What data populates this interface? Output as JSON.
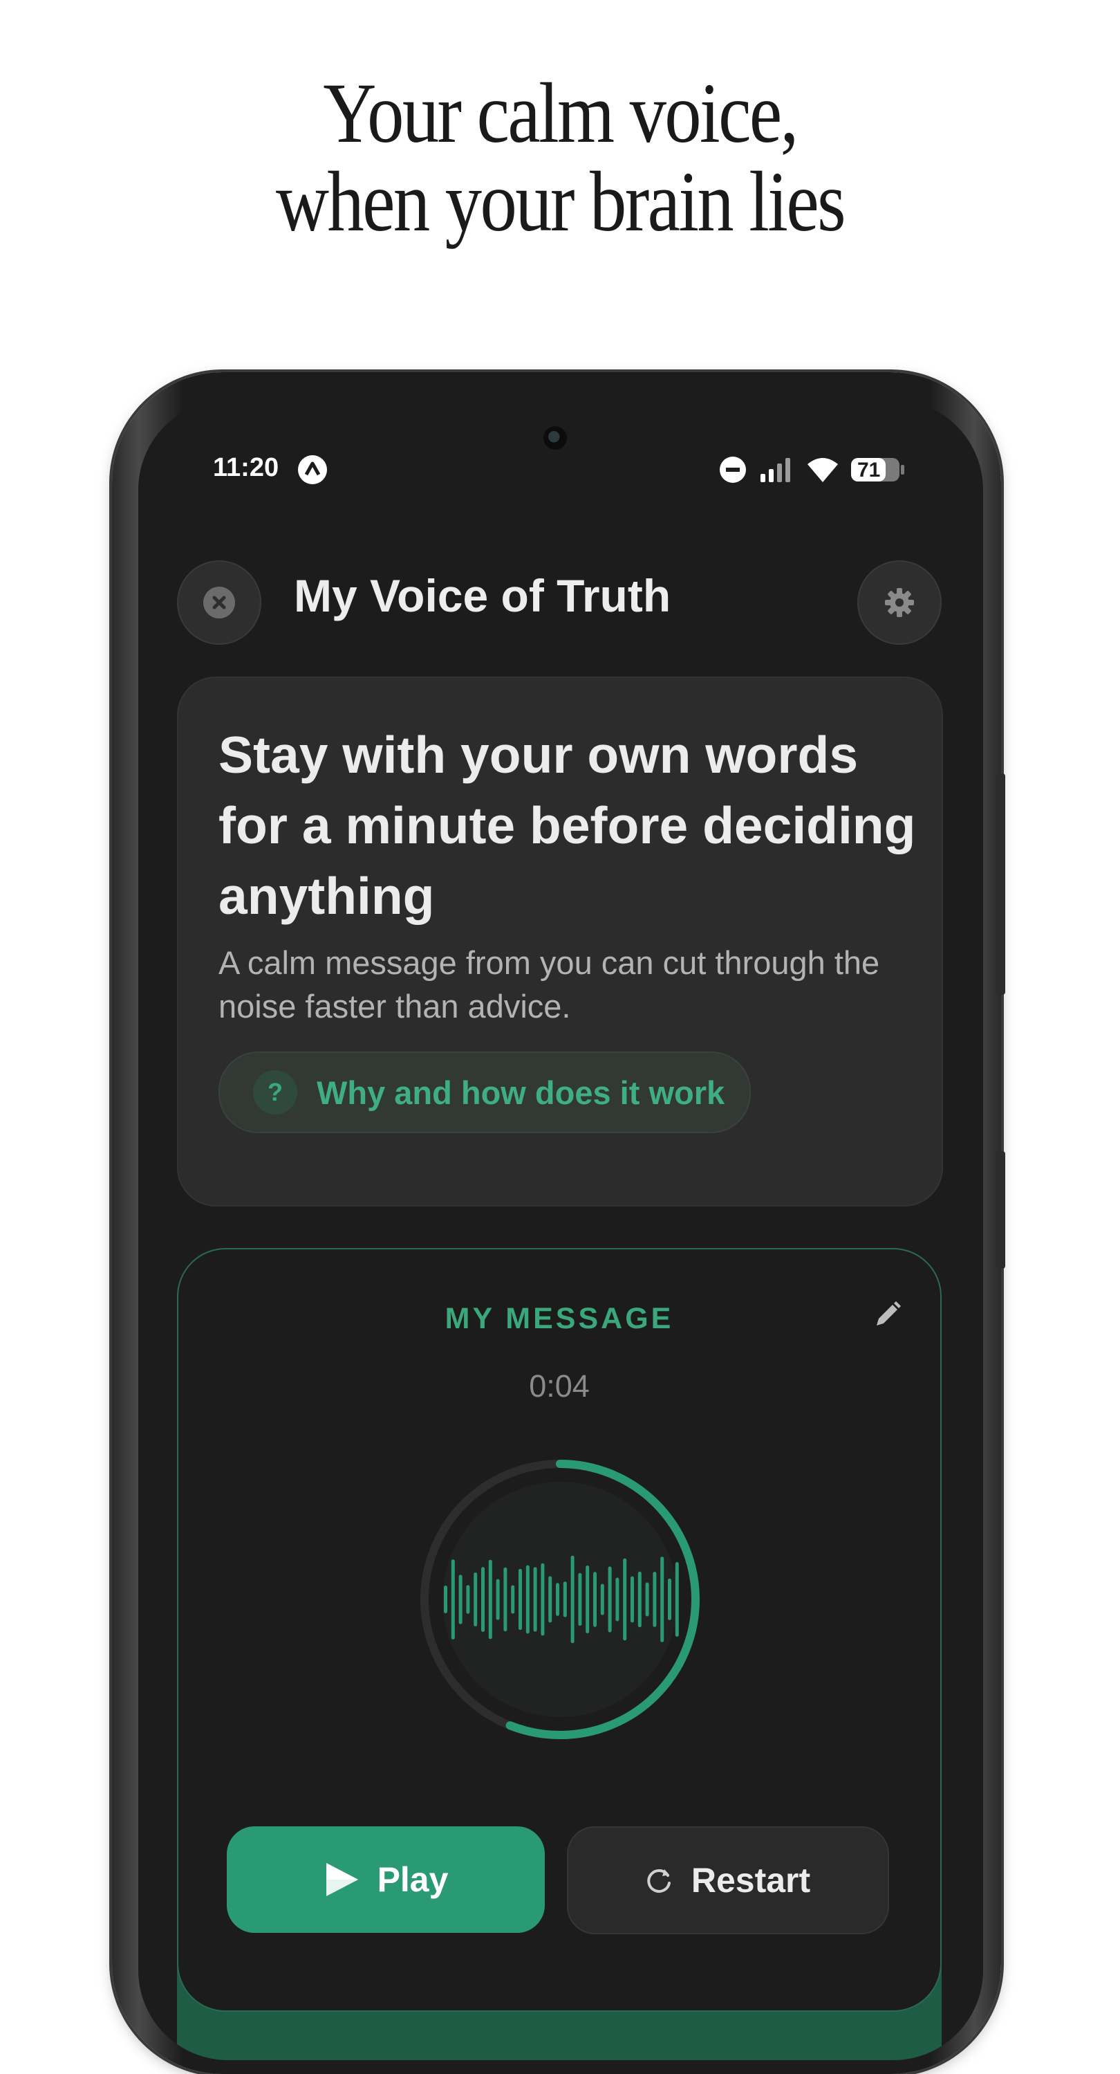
{
  "headline": {
    "line1": "Your calm voice,",
    "line2": "when your brain lies"
  },
  "status_bar": {
    "time": "11:20",
    "battery": "71"
  },
  "app": {
    "title": "My Voice of Truth"
  },
  "info_card": {
    "heading": "Stay with your own words for a minute before deciding anything",
    "body": "A calm message from you can cut through the noise faster than advice.",
    "why_icon": "?",
    "why_label": "Why and how does it work"
  },
  "message_card": {
    "label": "MY MESSAGE",
    "time": "0:04",
    "playback_progress": 0.56,
    "play_label": "Play",
    "restart_label": "Restart"
  },
  "colors": {
    "accent": "#2a9a74",
    "accent_text": "#3fae82",
    "background": "#1c1c1d",
    "card": "#2c2c2d"
  }
}
